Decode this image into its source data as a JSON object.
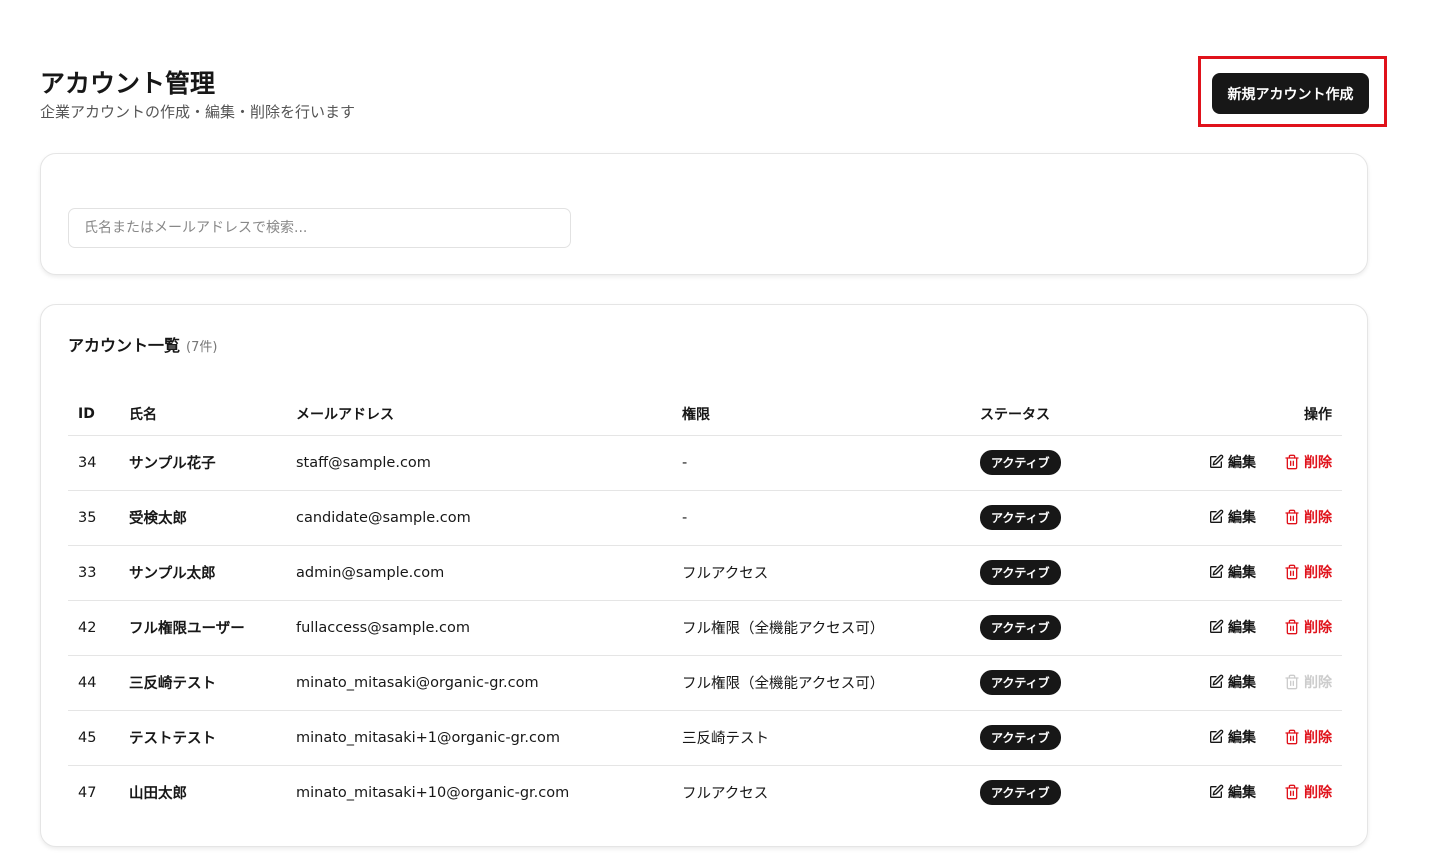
{
  "header": {
    "title": "アカウント管理",
    "subtitle": "企業アカウントの作成・編集・削除を行います",
    "new_button": "新規アカウント作成"
  },
  "search": {
    "placeholder": "氏名またはメールアドレスで検索..."
  },
  "list": {
    "title": "アカウント一覧",
    "count": "(7件)",
    "columns": [
      "ID",
      "氏名",
      "メールアドレス",
      "権限",
      "ステータス",
      "操作"
    ],
    "edit_label": "編集",
    "delete_label": "削除",
    "rows": [
      {
        "id": "34",
        "name": "サンプル花子",
        "email": "staff@sample.com",
        "role": "-",
        "status": "アクティブ",
        "delete_disabled": false
      },
      {
        "id": "35",
        "name": "受検太郎",
        "email": "candidate@sample.com",
        "role": "-",
        "status": "アクティブ",
        "delete_disabled": false
      },
      {
        "id": "33",
        "name": "サンプル太郎",
        "email": "admin@sample.com",
        "role": "フルアクセス",
        "status": "アクティブ",
        "delete_disabled": false
      },
      {
        "id": "42",
        "name": "フル権限ユーザー",
        "email": "fullaccess@sample.com",
        "role": "フル権限（全機能アクセス可）",
        "status": "アクティブ",
        "delete_disabled": false
      },
      {
        "id": "44",
        "name": "三反崎テスト",
        "email": "minato_mitasaki@organic-gr.com",
        "role": "フル権限（全機能アクセス可）",
        "status": "アクティブ",
        "delete_disabled": true
      },
      {
        "id": "45",
        "name": "テストテスト",
        "email": "minato_mitasaki+1@organic-gr.com",
        "role": "三反崎テスト",
        "status": "アクティブ",
        "delete_disabled": false
      },
      {
        "id": "47",
        "name": "山田太郎",
        "email": "minato_mitasaki+10@organic-gr.com",
        "role": "フルアクセス",
        "status": "アクティブ",
        "delete_disabled": false
      }
    ]
  }
}
